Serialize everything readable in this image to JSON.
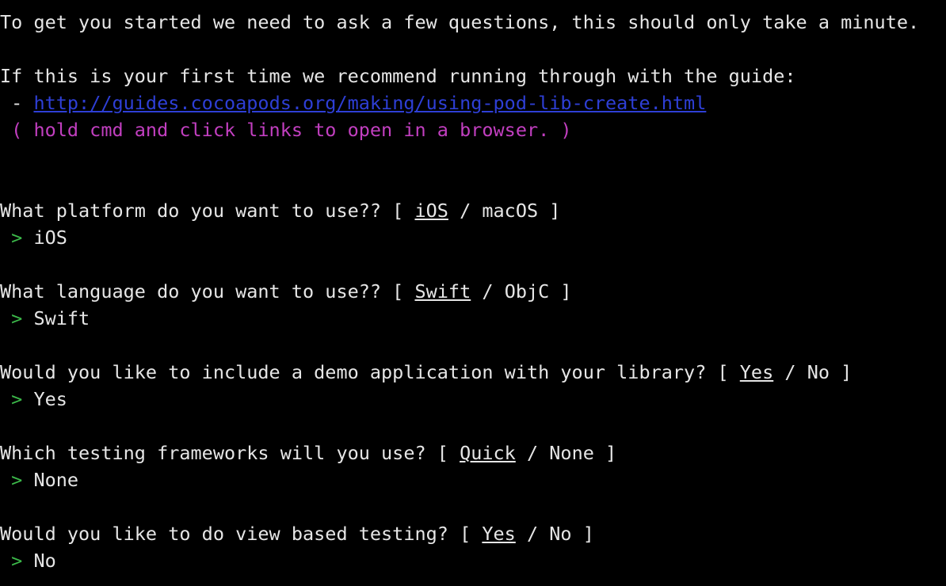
{
  "colors": {
    "background": "#000000",
    "text": "#e6e6e6",
    "link": "#2e3fd6",
    "hint": "#c23fc0",
    "prompt": "#3cb94a"
  },
  "intro": {
    "line1": "To get you started we need to ask a few questions, this should only take a minute.",
    "line2": "If this is your first time we recommend running through with the guide:",
    "bullet": " - ",
    "link": "http://guides.cocoapods.org/making/using-pod-lib-create.html",
    "hint": " ( hold cmd and click links to open in a browser. )"
  },
  "prompt_symbol": " > ",
  "questions": [
    {
      "text": "What platform do you want to use?? [ ",
      "default": "iOS",
      "separator": " / ",
      "alternative": "macOS",
      "close": " ]",
      "answer": "iOS"
    },
    {
      "text": "What language do you want to use?? [ ",
      "default": "Swift",
      "separator": " / ",
      "alternative": "ObjC",
      "close": " ]",
      "answer": "Swift"
    },
    {
      "text": "Would you like to include a demo application with your library? [ ",
      "default": "Yes",
      "separator": " / ",
      "alternative": "No",
      "close": " ]",
      "answer": "Yes"
    },
    {
      "text": "Which testing frameworks will you use? [ ",
      "default": "Quick",
      "separator": " / ",
      "alternative": "None",
      "close": " ]",
      "answer": "None"
    },
    {
      "text": "Would you like to do view based testing? [ ",
      "default": "Yes",
      "separator": " / ",
      "alternative": "No",
      "close": " ]",
      "answer": "No"
    }
  ]
}
